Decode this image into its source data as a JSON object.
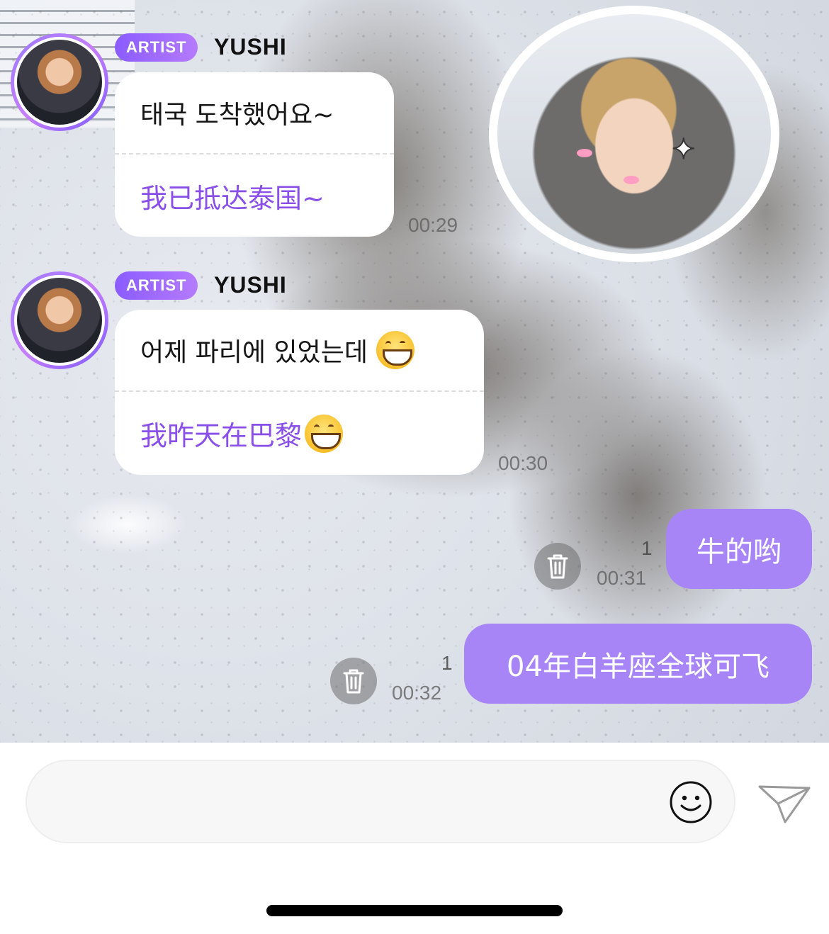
{
  "messages_in": [
    {
      "badge": "ARTIST",
      "sender": "YUSHI",
      "original": "태국 도착했어요~",
      "translation": "我已抵达泰国~",
      "time": "00:29"
    },
    {
      "badge": "ARTIST",
      "sender": "YUSHI",
      "original": "어제 파리에 있었는데",
      "translation": "我昨天在巴黎",
      "emoji": "grinning-face-with-smiling-eyes",
      "time": "00:30"
    }
  ],
  "messages_out": [
    {
      "text": "牛的哟",
      "unread": "1",
      "time": "00:31"
    },
    {
      "text": "04年白羊座全球可飞",
      "unread": "1",
      "time": "00:32"
    }
  ],
  "input": {
    "placeholder": ""
  },
  "colors": {
    "accent": "#a885f6",
    "translation_text": "#8a4fe8",
    "badge_gradient": [
      "#8a5cff",
      "#b57bff"
    ]
  },
  "icons": {
    "emoji_button": "smiley-icon",
    "send_button": "paper-plane-icon",
    "delete_button": "trash-icon"
  }
}
